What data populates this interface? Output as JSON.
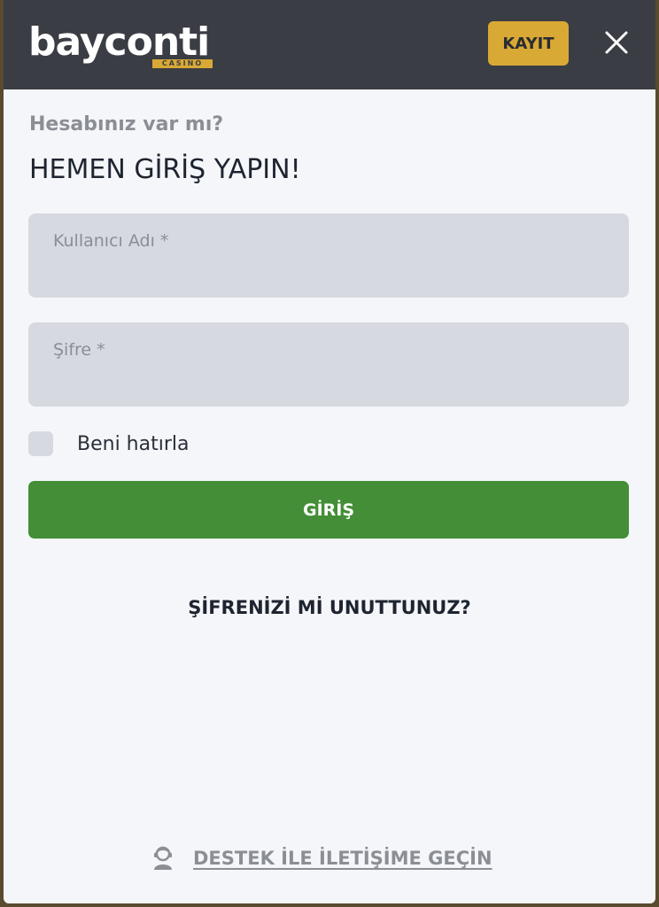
{
  "header": {
    "logo": {
      "word": "bayconti",
      "sub": "CASINO"
    },
    "register_label": "KAYIT",
    "close_icon": "close-icon"
  },
  "login": {
    "subtitle": "Hesabınız var mı?",
    "title": "HEMEN GİRİŞ YAPIN!",
    "username": {
      "label": "Kullanıcı Adı *",
      "value": ""
    },
    "password": {
      "label": "Şifre *",
      "value": ""
    },
    "remember_label": "Beni hatırla",
    "remember_checked": false,
    "submit_label": "GİRİŞ",
    "forgot_label": "ŞİFRENİZİ Mİ UNUTTUNUZ?"
  },
  "support": {
    "icon": "support-agent-icon",
    "label": "DESTEK İLE İLETİŞİME GEÇİN"
  },
  "colors": {
    "header_bg": "#3a3d44",
    "accent_gold": "#d9a935",
    "login_green": "#438e36",
    "panel_bg": "#f4f6f9",
    "field_bg": "#d6d9df"
  }
}
